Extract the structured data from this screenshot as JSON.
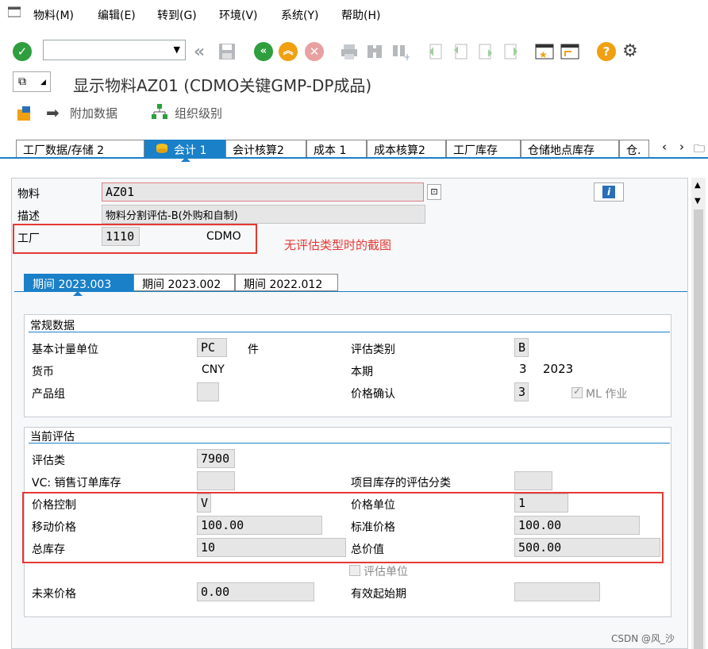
{
  "menu": {
    "items": [
      "物料(M)",
      "编辑(E)",
      "转到(G)",
      "环境(V)",
      "系统(Y)",
      "帮助(H)"
    ]
  },
  "title": "显示物料AZ01 (CDMO关键GMP-DP成品)",
  "app_toolbar": {
    "additional_data": "附加数据",
    "org_levels": "组织级别"
  },
  "tabs": [
    "工厂数据/存储 2",
    "会计 1",
    "会计核算2",
    "成本 1",
    "成本核算2",
    "工厂库存",
    "仓储地点库存",
    "仓."
  ],
  "header": {
    "material_label": "物料",
    "material_value": "AZ01",
    "desc_label": "描述",
    "desc_value": "物料分割评估-B(外购和自制)",
    "plant_label": "工厂",
    "plant_value": "1110",
    "plant_name": "CDMO"
  },
  "annotation": "无评估类型时的截图",
  "period_tabs": [
    "期间 2023.003",
    "期间 2023.002",
    "期间 2022.012"
  ],
  "general": {
    "title": "常规数据",
    "base_uom_label": "基本计量单位",
    "base_uom": "PC",
    "base_uom_text": "件",
    "valuation_cat_label": "评估类别",
    "valuation_cat": "B",
    "currency_label": "货币",
    "currency": "CNY",
    "current_period_label": "本期",
    "current_period": "3",
    "current_year": "2023",
    "product_group_label": "产品组",
    "price_determination_label": "价格确认",
    "price_determination": "3",
    "ml_active_label": "ML 作业"
  },
  "valuation": {
    "title": "当前评估",
    "valuation_class_label": "评估类",
    "valuation_class": "7900",
    "vc_sales_label": "VC: 销售订单库存",
    "project_stock_label": "项目库存的评估分类",
    "price_control_label": "价格控制",
    "price_control": "V",
    "price_unit_label": "价格单位",
    "price_unit": "1",
    "moving_price_label": "移动价格",
    "moving_price": "100.00",
    "standard_price_label": "标准价格",
    "standard_price": "100.00",
    "total_stock_label": "总库存",
    "total_stock": "10",
    "total_value_label": "总价值",
    "total_value": "500.00",
    "valuated_unit_label": "评估单位",
    "future_price_label": "未来价格",
    "future_price": "0.00",
    "valid_from_label": "有效起始期"
  },
  "watermark": "CSDN @风_沙",
  "colors": {
    "accent": "#1a80c8",
    "annotation_red": "#e53935",
    "enter_green": "#2e9e3e",
    "back_green": "#2e9e3e",
    "exit_orange": "#f0a010",
    "cancel_red": "#e05a5a",
    "help_orange": "#f0a010"
  },
  "icons": [
    "menu-icon",
    "enter-icon",
    "back-icon",
    "save-icon",
    "back-green-icon",
    "exit-icon",
    "cancel-icon",
    "print-icon",
    "find-icon",
    "find-next-icon",
    "first-page-icon",
    "prev-page-icon",
    "next-page-icon",
    "last-page-icon",
    "create-session-icon",
    "shortcut-icon",
    "help-icon",
    "settings-icon",
    "info-icon"
  ]
}
